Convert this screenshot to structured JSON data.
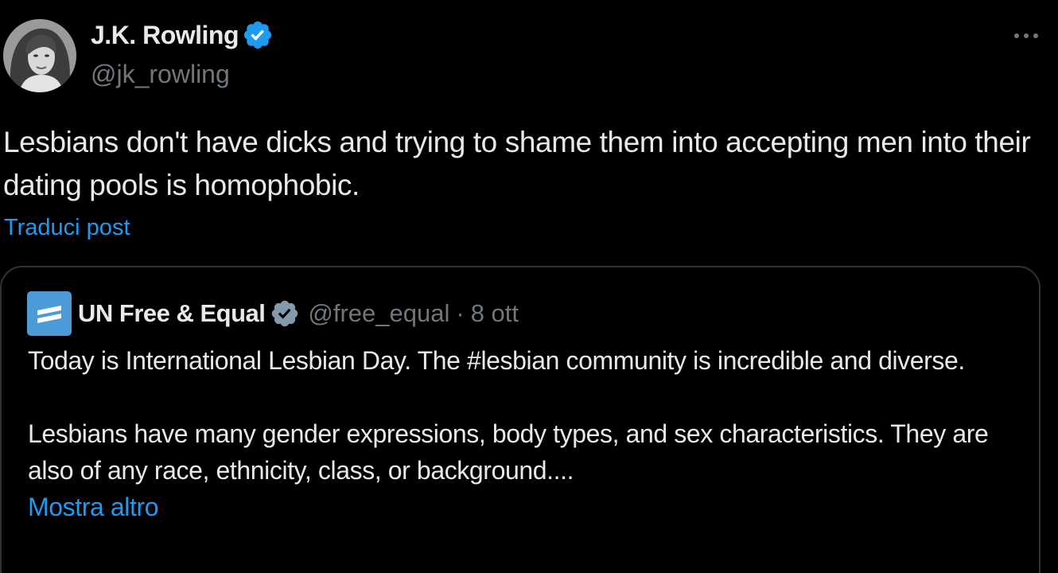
{
  "author": {
    "display_name": "J.K. Rowling",
    "handle": "@jk_rowling",
    "verified_icon": "verified-badge-icon",
    "avatar_icon": "avatar"
  },
  "tweet": {
    "text": "Lesbians don't have dicks and trying to shame them into accepting men into their dating pools is homophobic.",
    "translate_label": "Traduci post",
    "more_icon": "more-options-icon"
  },
  "quote": {
    "display_name": "UN Free & Equal",
    "handle": "@free_equal",
    "separator": "·",
    "date": "8 ott",
    "paragraph_1": "Today is International Lesbian Day. The #lesbian community is incredible and diverse.",
    "paragraph_2": "Lesbians have many gender expressions, body types, and sex characteristics. They are also of any race, ethnicity, class, or background....",
    "show_more_label": "Mostra altro",
    "logo_icon": "un-free-equal-logo-icon"
  },
  "colors": {
    "background": "#000000",
    "text": "#e7e9ea",
    "secondary": "#71767b",
    "link": "#1d9bf0",
    "verified_user": "#1d9bf0",
    "verified_org": "#829aab",
    "border": "#2f3336",
    "logo_bg": "#4a9bd8"
  }
}
